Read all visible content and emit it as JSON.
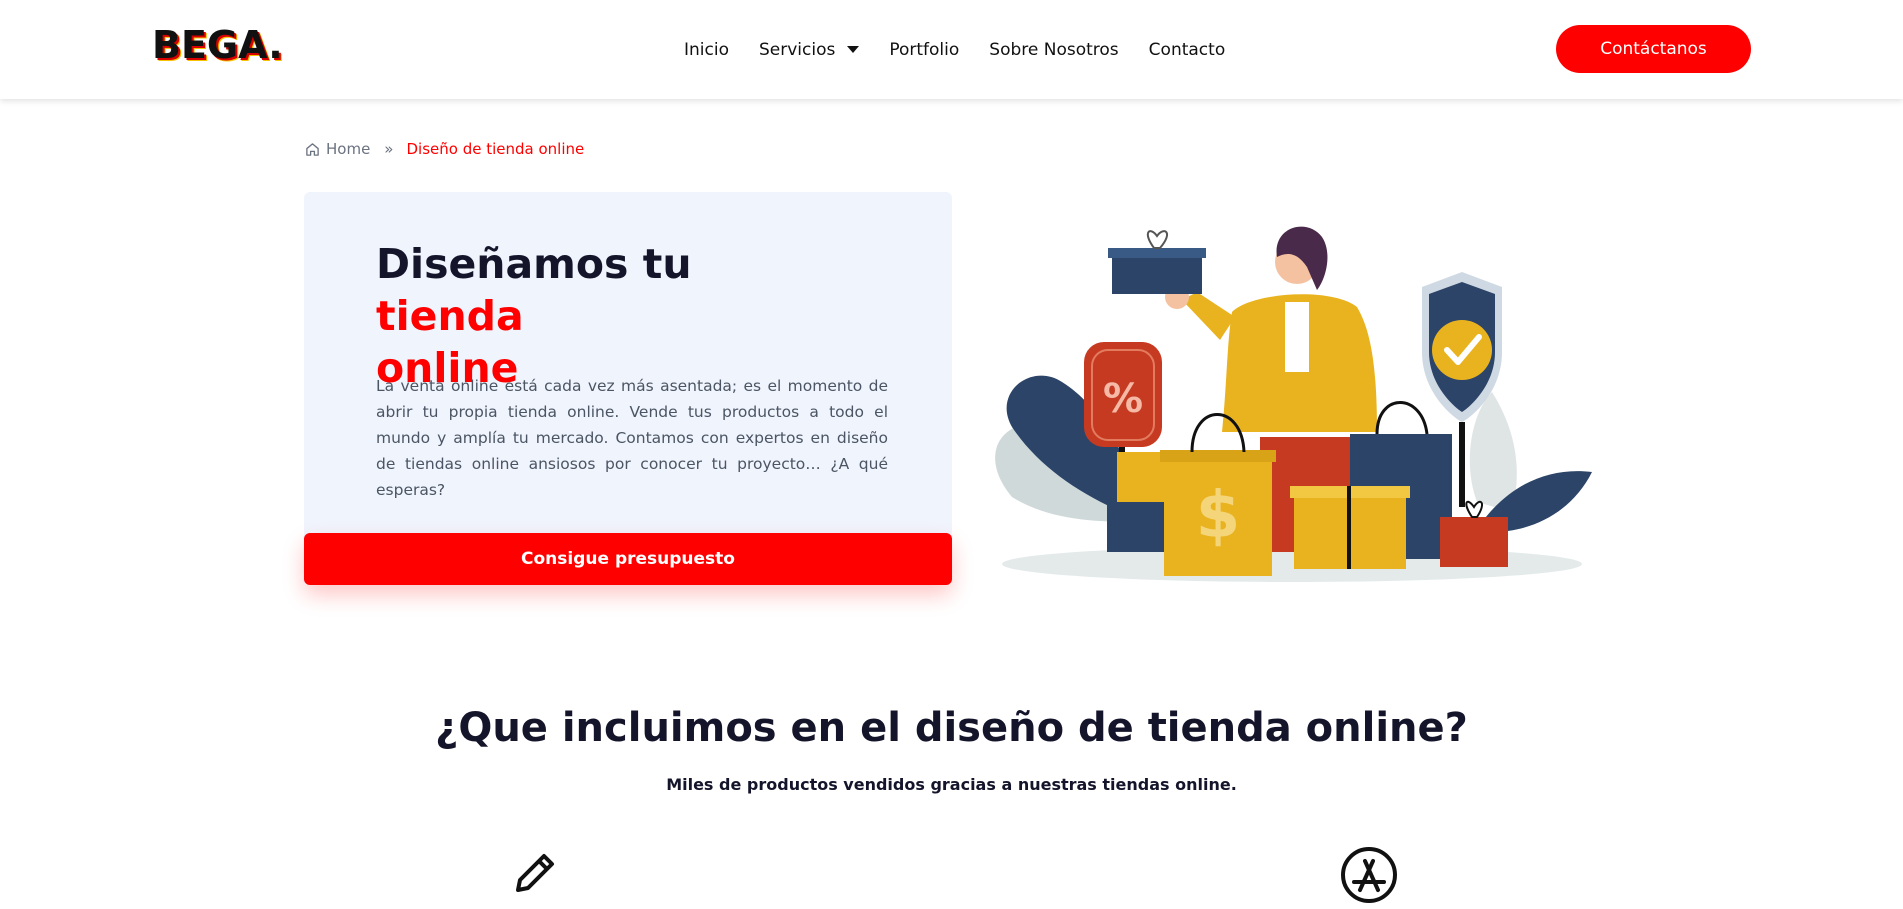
{
  "header": {
    "logo_text": "BEGA.",
    "nav": [
      {
        "label": "Inicio"
      },
      {
        "label": "Servicios",
        "has_dropdown": true
      },
      {
        "label": "Portfolio"
      },
      {
        "label": "Sobre Nosotros"
      },
      {
        "label": "Contacto"
      }
    ],
    "cta_label": "Contáctanos"
  },
  "breadcrumb": {
    "home_label": "Home",
    "separator": "»",
    "current": "Diseño de tienda online"
  },
  "hero": {
    "title_part1": "Diseñamos tu",
    "title_accent_1": "tienda",
    "title_accent_2": "online",
    "text": "La venta online está cada vez más asentada; es el momento de abrir tu propia tienda online. Vende tus productos a todo el mundo y amplía tu mercado. Contamos con expertos en diseño de tiendas online ansiosos por conocer tu proyecto… ¿A qué esperas?",
    "button_label": "Consigue presupuesto",
    "illustration_labels": {
      "percent": "%",
      "dollar": "$"
    }
  },
  "section": {
    "title": "¿Que incluimos en el diseño de tienda online?",
    "subtitle": "Miles de productos vendidos gracias a nuestras tiendas online.",
    "feature_icons": [
      "pencil-icon",
      "app-store-icon"
    ]
  },
  "colors": {
    "accent": "#ff0000",
    "hero_bg": "#f0f4fd",
    "dark_text": "#14142b",
    "navy": "#2b4468",
    "gold": "#e9b320",
    "brick": "#c63a22"
  }
}
